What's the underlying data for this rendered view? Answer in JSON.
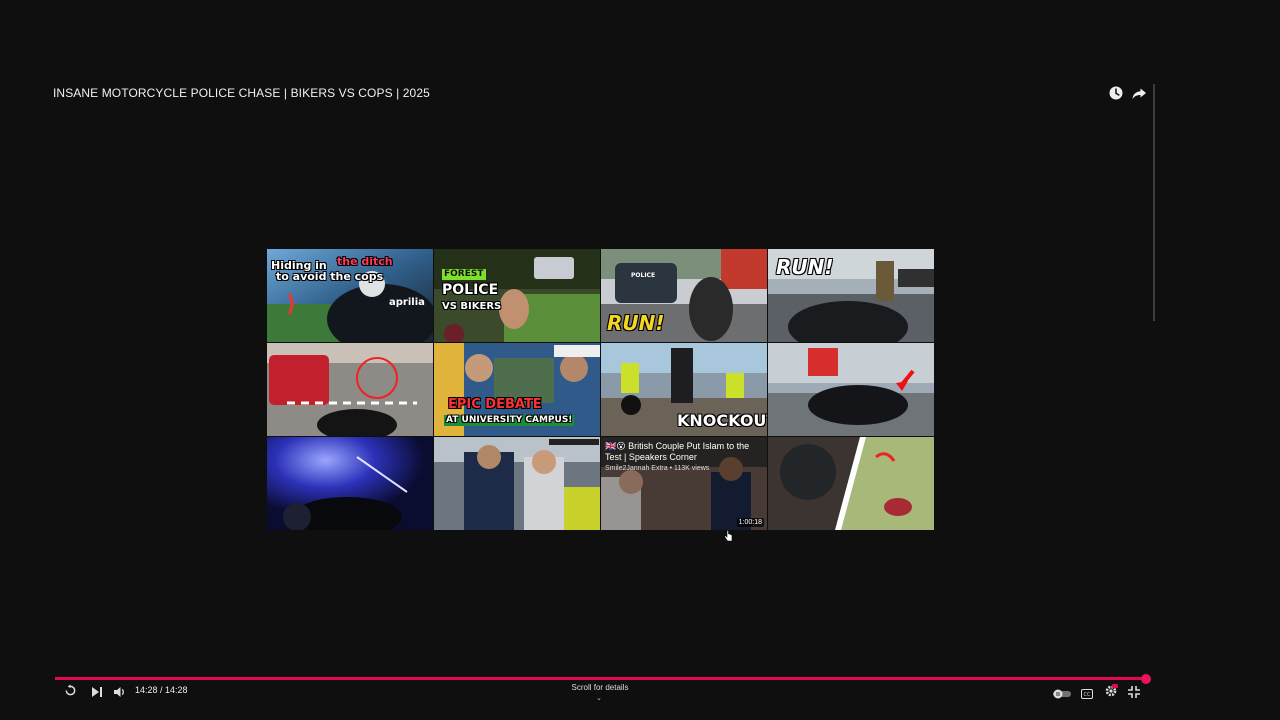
{
  "video": {
    "title": "INSANE MOTORCYCLE POLICE CHASE | BIKERS VS COPS | 2025"
  },
  "top_icons": [
    "watch-later-icon",
    "share-icon"
  ],
  "endscreen": {
    "tiles": [
      {
        "texts": [
          "Hiding in",
          "the ditch",
          "to avoid the cops",
          "aprilia"
        ]
      },
      {
        "texts": [
          "FOREST",
          "POLICE",
          "VS BIKERS"
        ]
      },
      {
        "texts": [
          "POLICE",
          "RUN!"
        ]
      },
      {
        "texts": [
          "RUN!"
        ]
      },
      {
        "texts": []
      },
      {
        "texts": [
          "EPIC DEBATE",
          "AT UNIVERSITY CAMPUS!"
        ]
      },
      {
        "texts": [
          "KNOCKOUT!"
        ]
      },
      {
        "texts": []
      },
      {
        "texts": []
      },
      {
        "texts": []
      },
      {
        "texts": [],
        "hover": {
          "title": "🇬🇧😮 British Couple Put Islam to the Test | Speakers Corner",
          "meta": "Smile2Jannah Extra • 113K views",
          "duration": "1:00:18"
        }
      },
      {
        "texts": []
      }
    ]
  },
  "controls": {
    "time": "14:28 / 14:28",
    "progress_fraction": 1.0,
    "scroll_hint": "Scroll for details",
    "accent_color": "#e0094f"
  }
}
